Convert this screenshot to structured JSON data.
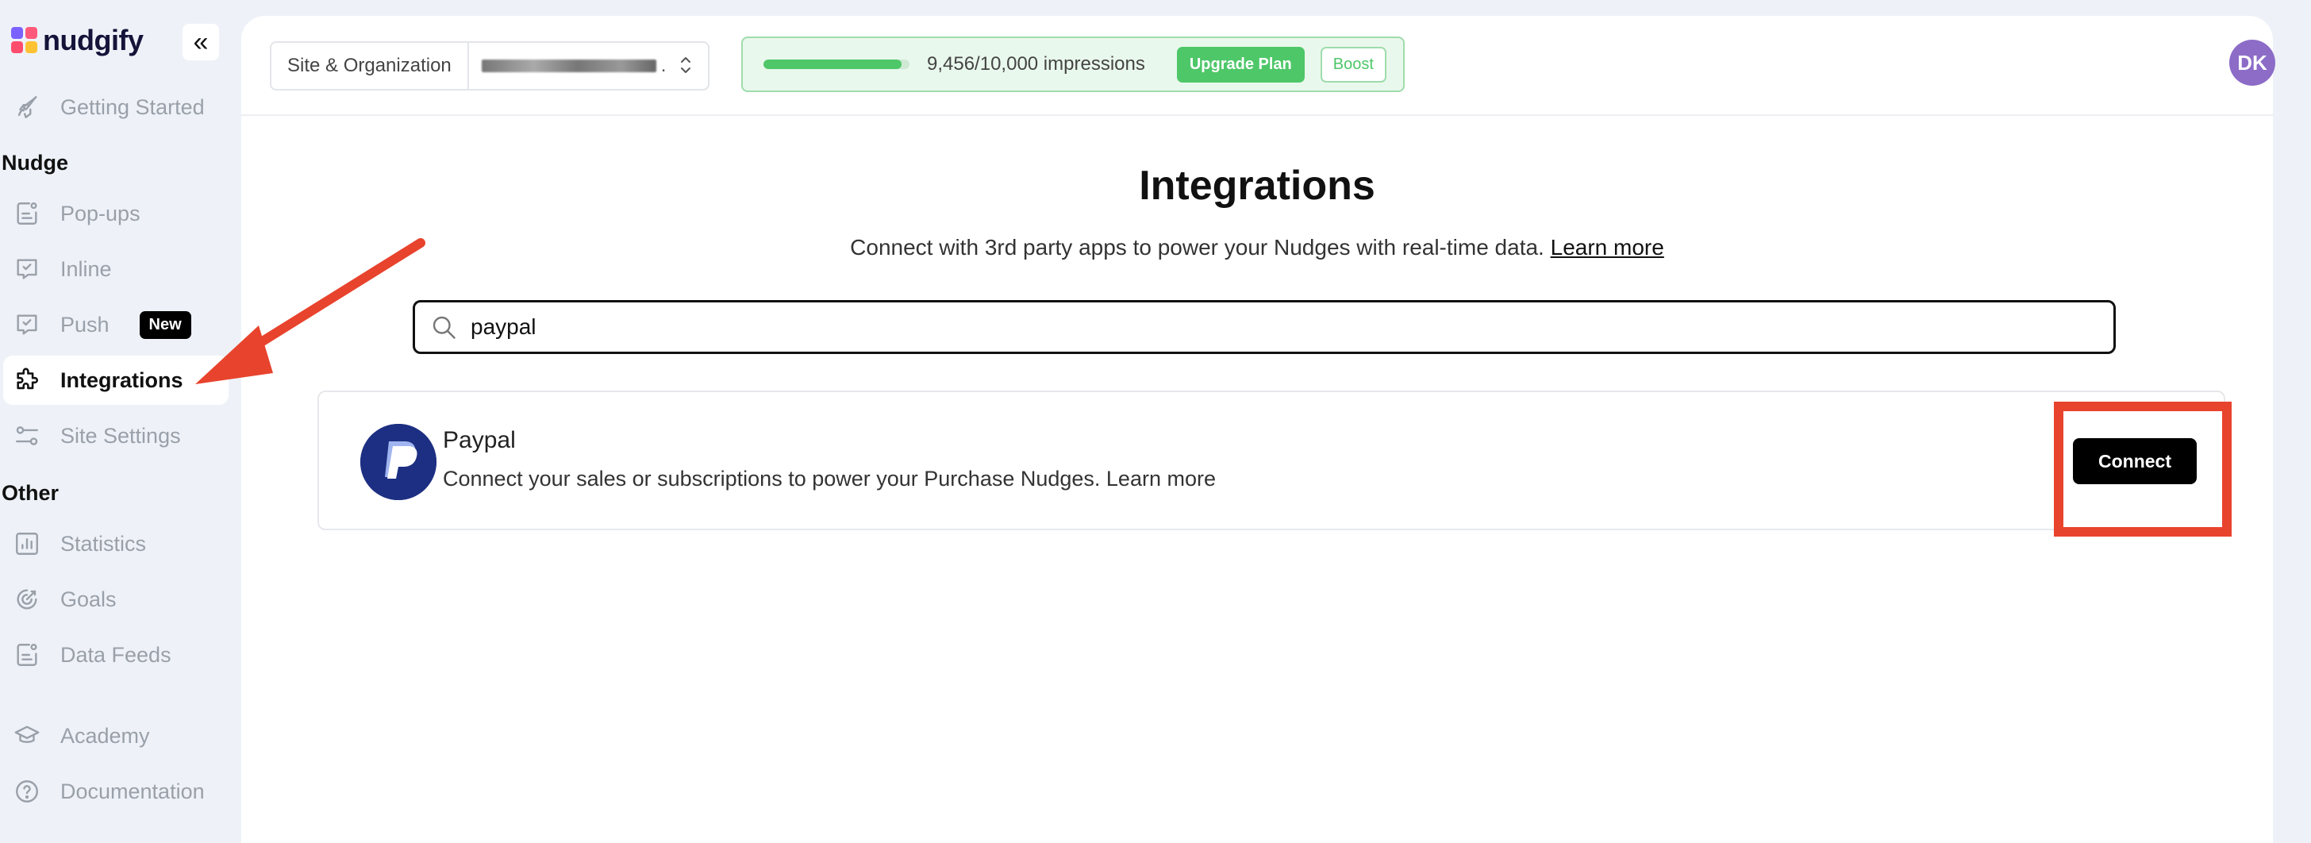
{
  "brand": {
    "name": "nudgify"
  },
  "sidebar": {
    "collapse_icon": "double-chevron-left-icon",
    "getting_started": "Getting Started",
    "section_nudge": "Nudge",
    "section_other": "Other",
    "items": [
      {
        "label": "Pop-ups",
        "icon": "popup-icon"
      },
      {
        "label": "Inline",
        "icon": "inline-icon"
      },
      {
        "label": "Push",
        "icon": "push-icon",
        "badge": "New"
      },
      {
        "label": "Integrations",
        "icon": "puzzle-icon",
        "active": true
      },
      {
        "label": "Site Settings",
        "icon": "sliders-icon"
      },
      {
        "label": "Statistics",
        "icon": "chart-icon"
      },
      {
        "label": "Goals",
        "icon": "target-icon"
      },
      {
        "label": "Data Feeds",
        "icon": "feed-icon"
      },
      {
        "label": "Academy",
        "icon": "graduation-cap-icon"
      },
      {
        "label": "Documentation",
        "icon": "question-icon"
      }
    ]
  },
  "header": {
    "site_org_label": "Site & Organization",
    "site_value_suffix": ".",
    "impressions_text": "9,456/10,000 impressions",
    "impressions_progress": 0.9456,
    "upgrade_label": "Upgrade Plan",
    "boost_label": "Boost",
    "avatar_initials": "DK"
  },
  "page": {
    "title": "Integrations",
    "subtitle": "Connect with 3rd party apps to power your Nudges with real-time data.",
    "learn_more": "Learn more",
    "search_value": "paypal"
  },
  "integration": {
    "name": "Paypal",
    "description": "Connect your sales or subscriptions to power your Purchase Nudges. Learn more",
    "connect_label": "Connect"
  },
  "colors": {
    "accent_green": "#4ec768",
    "annotation_red": "#e8432d",
    "avatar": "#8c6cc7",
    "paypal_blue": "#1d2f82"
  }
}
